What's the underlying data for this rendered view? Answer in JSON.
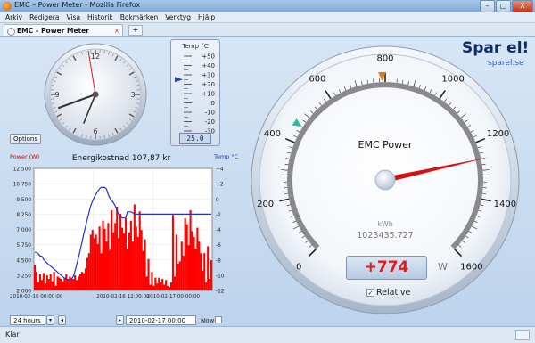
{
  "window": {
    "title": "EMC – Power Meter - Mozilla Firefox",
    "buttons": [
      "–",
      "□",
      "X"
    ]
  },
  "menu": [
    "Arkiv",
    "Redigera",
    "Visa",
    "Historik",
    "Bokmärken",
    "Verktyg",
    "Hjälp"
  ],
  "tab": {
    "label": "EMC – Power Meter",
    "close": "×",
    "new": "+"
  },
  "clock": {
    "numerals": [
      "12",
      "3",
      "6",
      "9"
    ]
  },
  "thermo": {
    "title": "Temp °C",
    "scale": [
      "+50",
      "+40",
      "+30",
      "+20",
      "+10",
      "0",
      "-10",
      "-20",
      "-30"
    ],
    "value": "25.0",
    "reading": 25
  },
  "options_label": "Options",
  "chart_data": {
    "type": "area",
    "title": "Energikostnad 107,87 kr",
    "ylabel": "Power (W)",
    "y2label": "Temp °C",
    "left_ticks": [
      "12 500",
      "10 750",
      "9 500",
      "8 250",
      "7 000",
      "5 750",
      "4 500",
      "3 250",
      "2 000"
    ],
    "right_ticks": [
      "+4",
      "+2",
      "0",
      "-2",
      "-4",
      "-6",
      "-8",
      "-10",
      "-12"
    ],
    "x_ticks": [
      "2010-02-16 00:00:00",
      "2010-02-16 12:00:00",
      "2010-02-17 00:00:00"
    ],
    "ylim": [
      2000,
      12500
    ],
    "y2lim": [
      -12,
      4
    ],
    "series": [
      {
        "name": "Power (W)",
        "color": "#ff0000",
        "values": [
          4200,
          3600,
          2700,
          3400,
          2900,
          3500,
          2600,
          3300,
          3000,
          3400,
          2800,
          3600,
          2400,
          3200,
          3100,
          3000,
          2800,
          3100,
          3400,
          3000,
          3200,
          3100,
          3000,
          3300,
          2900,
          3200,
          3400,
          3600,
          3500,
          3900,
          4800,
          5200,
          6800,
          7200,
          6500,
          6800,
          6000,
          7500,
          5200,
          8000,
          7300,
          6200,
          7800,
          5500,
          8900,
          7000,
          7800,
          9200,
          6500,
          8600,
          7400,
          6900,
          8200,
          5600,
          7000,
          8000,
          6200,
          9400,
          7500,
          6600,
          8800,
          7200,
          5400,
          6400,
          3200,
          4700,
          2500,
          3600,
          2400,
          3100,
          2600,
          3100,
          2700,
          3000,
          2500,
          2900,
          2400,
          2300,
          2700,
          8500,
          3200,
          6800,
          4300,
          4500,
          6200,
          5000,
          8200,
          7700,
          5900,
          8900,
          7100,
          6600,
          5600,
          7400,
          6200,
          5200,
          3700,
          5200,
          2700,
          5800,
          3000,
          4600
        ]
      },
      {
        "name": "Temp °C",
        "color": "#2233cc",
        "values": [
          -7.0,
          -7.0,
          -7.2,
          -7.5,
          -7.5,
          -7.9,
          -8.2,
          -8.4,
          -8.6,
          -8.8,
          -9.0,
          -9.2,
          -9.4,
          -9.6,
          -9.8,
          -10.0,
          -10.2,
          -10.4,
          -10.5,
          -10.6,
          -10.6,
          -10.5,
          -10.2,
          -9.5,
          -8.6,
          -7.7,
          -6.7,
          -5.7,
          -4.6,
          -3.7,
          -2.7,
          -1.8,
          -0.9,
          -0.3,
          0.2,
          0.6,
          1.0,
          1.3,
          1.5,
          1.5,
          1.5,
          1.3,
          0.6,
          0.1,
          -0.2,
          -0.5,
          -0.9,
          -1.5,
          -2.0,
          -2.3,
          -2.5,
          -2.5,
          -2.5,
          -1.7,
          -1.7,
          -1.7,
          -1.8,
          -2.0,
          -2.0,
          -2.0,
          -2.0,
          -2.0,
          -2.0,
          -2.0,
          -2.0,
          -2.0,
          -2.0,
          -2.0,
          -2.0,
          -2.0,
          -2.0,
          -2.0,
          -2.0,
          -2.0,
          -2.0,
          -2.0,
          -2.0,
          -2.0,
          -2.0,
          -2.0,
          -2.0,
          -2.0,
          -2.0,
          -2.0,
          -2.0,
          -2.0,
          -2.0,
          -2.0,
          -2.0,
          -2.0,
          -2.0,
          -2.0,
          -2.0,
          -2.0,
          -2.0,
          -2.0,
          -2.0,
          -2.0,
          -2.0,
          -2.0,
          -2.0,
          -2.0
        ]
      }
    ],
    "grid": true
  },
  "bottom": {
    "range": "24 hours",
    "date": "2010-02-17 00:00",
    "now": "Now"
  },
  "brand": {
    "title": "Spar el!",
    "sub": "sparel.se"
  },
  "gauge": {
    "title": "EMC Power",
    "labels": [
      "0",
      "200",
      "400",
      "600",
      "800",
      "1000",
      "1200",
      "1400",
      "1600"
    ],
    "kwh_label": "kWh",
    "kwh": "1023435.727",
    "value": 774,
    "reading": "+774",
    "unit": "W",
    "relative": "Relative",
    "orange_marker": 790,
    "teal_marker": 460,
    "needle": 1260
  },
  "status": "Klar",
  "colors": {
    "power": "#ff0000",
    "temp": "#2233cc",
    "accent": "#1d3d8f",
    "readout": "#e21b1b"
  }
}
